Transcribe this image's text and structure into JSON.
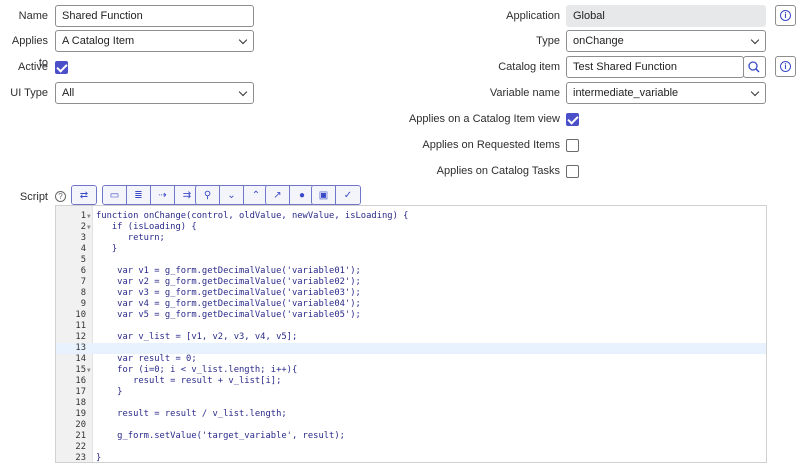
{
  "form": {
    "name_label": "Name",
    "name_value": "Shared Function",
    "applies_to_label": "Applies to",
    "applies_to_value": "A Catalog Item",
    "active_label": "Active",
    "active_checked": true,
    "ui_type_label": "UI Type",
    "ui_type_value": "All",
    "application_label": "Application",
    "application_value": "Global",
    "type_label": "Type",
    "type_value": "onChange",
    "catalog_item_label": "Catalog item",
    "catalog_item_value": "Test Shared Function",
    "variable_name_label": "Variable name",
    "variable_name_value": "intermediate_variable",
    "applies_item_view_label": "Applies on a Catalog Item view",
    "applies_item_view_checked": true,
    "applies_requested_label": "Applies on Requested Items",
    "applies_requested_checked": false,
    "applies_tasks_label": "Applies on Catalog Tasks",
    "applies_tasks_checked": false,
    "script_label": "Script",
    "info_icon": "i"
  },
  "toolbar": [
    "toggle-fullscreen",
    "comment",
    "format",
    "replace",
    "replace-all",
    "search",
    "next",
    "previous",
    "open-script",
    "help",
    "save",
    "syntax-check"
  ],
  "script": {
    "lines": [
      "function onChange(control, oldValue, newValue, isLoading) {",
      "   if (isLoading) {",
      "      return;",
      "   }",
      "",
      "    var v1 = g_form.getDecimalValue('variable01');",
      "    var v2 = g_form.getDecimalValue('variable02');",
      "    var v3 = g_form.getDecimalValue('variable03');",
      "    var v4 = g_form.getDecimalValue('variable04');",
      "    var v5 = g_form.getDecimalValue('variable05');",
      "",
      "    var v_list = [v1, v2, v3, v4, v5];",
      "",
      "    var result = 0;",
      "    for (i=0; i < v_list.length; i++){",
      "       result = result + v_list[i];",
      "    }",
      "",
      "    result = result / v_list.length;",
      "",
      "    g_form.setValue('target_variable', result);",
      "",
      "}"
    ],
    "fold_lines": [
      1,
      2,
      15
    ],
    "active_line": 13
  }
}
